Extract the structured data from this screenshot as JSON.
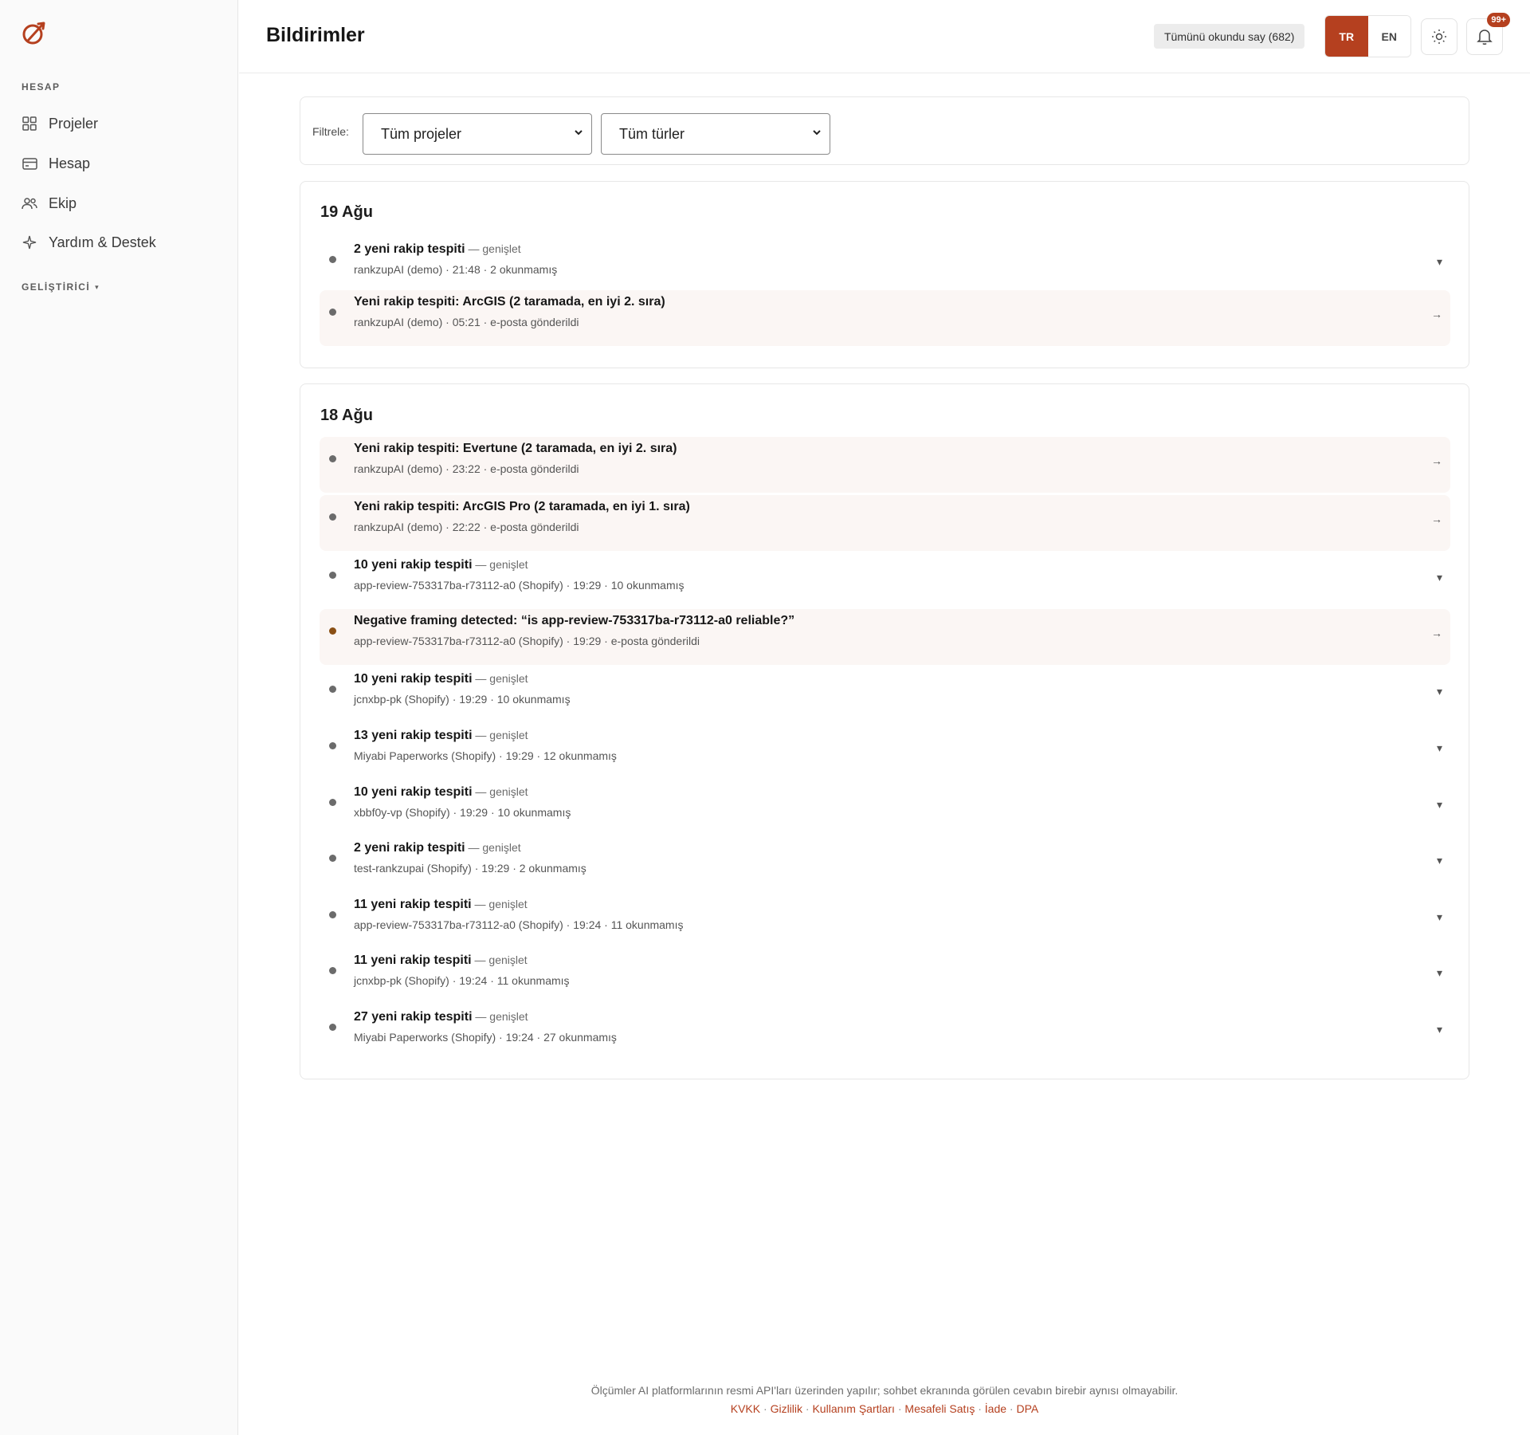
{
  "sidebar": {
    "section_account": "HESAP",
    "items": [
      {
        "label": "Projeler",
        "icon": "grid-icon"
      },
      {
        "label": "Hesap",
        "icon": "credit-card-icon"
      },
      {
        "label": "Ekip",
        "icon": "users-icon"
      },
      {
        "label": "Yardım & Destek",
        "icon": "sparkle-icon"
      }
    ],
    "developer_label": "GELİŞTİRİCİ",
    "developer_chevron": "▾"
  },
  "header": {
    "title": "Bildirimler",
    "mark_all_label": "Tümünü okundu say (682)",
    "lang_tr": "TR",
    "lang_en": "EN",
    "notification_badge": "99+"
  },
  "filters": {
    "label": "Filtrele:",
    "project_select": "Tüm projeler",
    "type_select": "Tüm türler"
  },
  "groups": [
    {
      "date": "19 Ağu",
      "rows": [
        {
          "title": "2 yeni rakip tespiti",
          "expand": " — genişlet",
          "meta": "rankzupAI (demo) · 21:48 · 2 okunmamış"
        },
        {
          "title": "Yeni rakip tespiti: ArcGIS (2 taramada, en iyi 2. sıra)",
          "meta": "rankzupAI (demo) · 05:21 · e-posta gönderildi"
        }
      ]
    },
    {
      "date": "18 Ağu",
      "rows": [
        {
          "title": "Yeni rakip tespiti: Evertune (2 taramada, en iyi 2. sıra)",
          "meta": "rankzupAI (demo) · 23:22 · e-posta gönderildi"
        },
        {
          "title": "Yeni rakip tespiti: ArcGIS Pro (2 taramada, en iyi 1. sıra)",
          "meta": "rankzupAI (demo) · 22:22 · e-posta gönderildi"
        },
        {
          "title": "10 yeni rakip tespiti",
          "expand": " — genişlet",
          "meta": "app-review-753317ba-r73112-a0 (Shopify) · 19:29 · 10 okunmamış"
        },
        {
          "title": "Negative framing detected: “is app-review-753317ba-r73112-a0 reliable?”",
          "meta": "app-review-753317ba-r73112-a0 (Shopify) · 19:29 · e-posta gönderildi"
        },
        {
          "title": "10 yeni rakip tespiti",
          "expand": " — genişlet",
          "meta": "jcnxbp-pk (Shopify) · 19:29 · 10 okunmamış"
        },
        {
          "title": "13 yeni rakip tespiti",
          "expand": " — genişlet",
          "meta": "Miyabi Paperworks (Shopify) · 19:29 · 12 okunmamış"
        },
        {
          "title": "10 yeni rakip tespiti",
          "expand": " — genişlet",
          "meta": "xbbf0y-vp (Shopify) · 19:29 · 10 okunmamış"
        },
        {
          "title": "2 yeni rakip tespiti",
          "expand": " — genişlet",
          "meta": "test-rankzupai (Shopify) · 19:29 · 2 okunmamış"
        },
        {
          "title": "11 yeni rakip tespiti",
          "expand": " — genişlet",
          "meta": "app-review-753317ba-r73112-a0 (Shopify) · 19:24 · 11 okunmamış"
        },
        {
          "title": "11 yeni rakip tespiti",
          "expand": " — genişlet",
          "meta": "jcnxbp-pk (Shopify) · 19:24 · 11 okunmamış"
        },
        {
          "title": "27 yeni rakip tespiti",
          "expand": " — genişlet",
          "meta": "Miyabi Paperworks (Shopify) · 19:24 · 27 okunmamış"
        }
      ]
    }
  ],
  "icons": {
    "expand": "▾",
    "open": "→"
  },
  "footer": {
    "note": "Ölçümler AI platformlarının resmi API'ları üzerinden yapılır; sohbet ekranında görülen cevabın birebir aynısı olmayabilir.",
    "links": [
      "KVKK",
      "Gizlilik",
      "Kullanım Şartları",
      "Mesafeli Satış",
      "İade",
      "DPA"
    ],
    "separator": " · "
  },
  "colors": {
    "accent": "#b5401f",
    "warning_dot": "#8a4f14",
    "highlight_row": "#fbf6f4"
  }
}
